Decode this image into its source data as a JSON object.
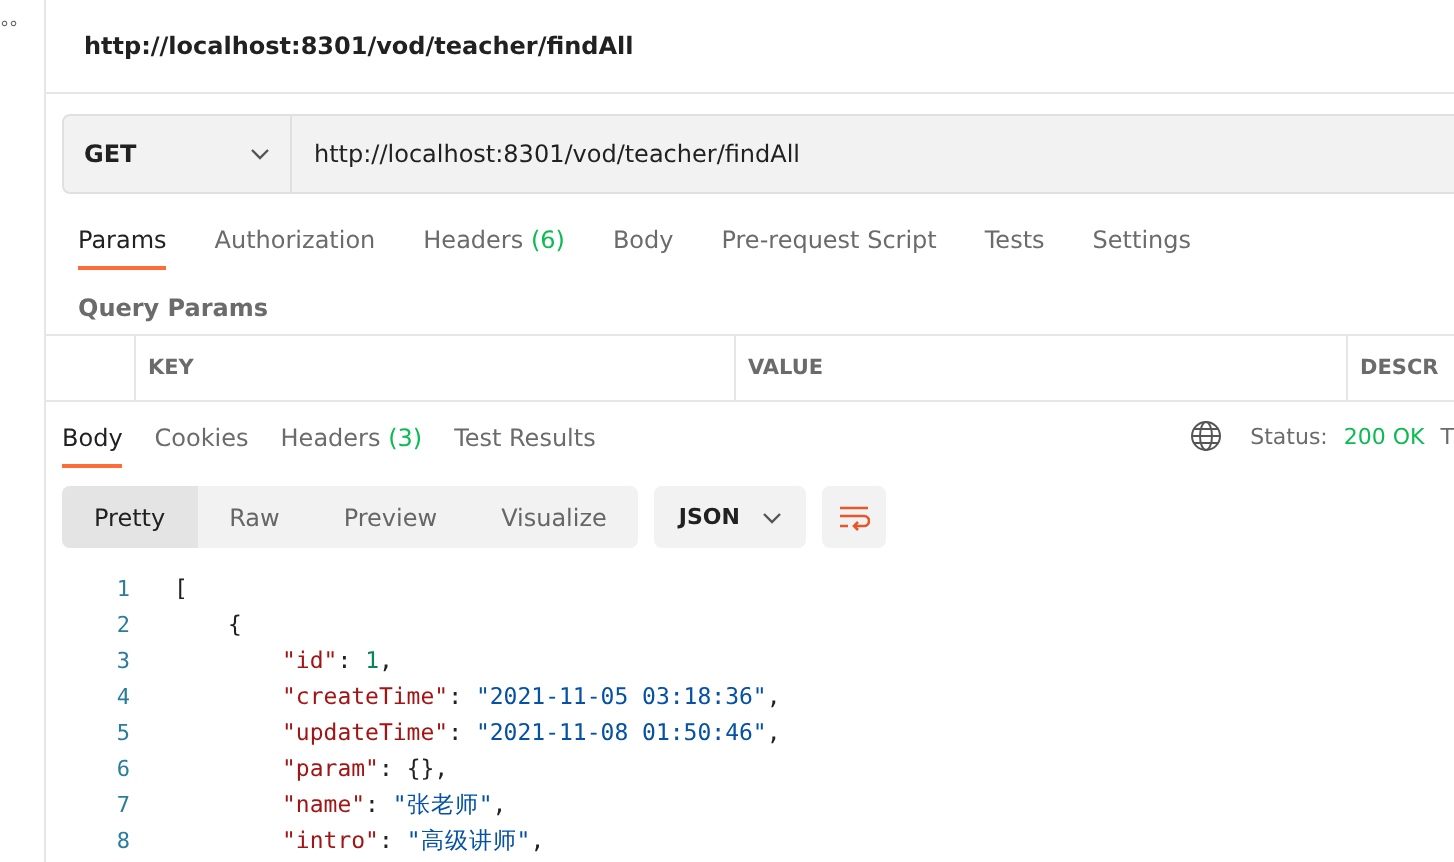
{
  "sidebar": {
    "icon_text": "°°"
  },
  "request": {
    "title": "http://localhost:8301/vod/teacher/findAll",
    "method": "GET",
    "url": "http://localhost:8301/vod/teacher/findAll"
  },
  "request_tabs": [
    {
      "label": "Params",
      "selected": true
    },
    {
      "label": "Authorization",
      "selected": false
    },
    {
      "label": "Headers",
      "count": "(6)",
      "selected": false
    },
    {
      "label": "Body",
      "selected": false
    },
    {
      "label": "Pre-request Script",
      "selected": false
    },
    {
      "label": "Tests",
      "selected": false
    },
    {
      "label": "Settings",
      "selected": false
    }
  ],
  "params": {
    "title": "Query Params",
    "columns": [
      "KEY",
      "VALUE",
      "DESCR"
    ]
  },
  "response_tabs": [
    {
      "label": "Body",
      "selected": true
    },
    {
      "label": "Cookies",
      "selected": false
    },
    {
      "label": "Headers",
      "count": "(3)",
      "selected": false
    },
    {
      "label": "Test Results",
      "selected": false
    }
  ],
  "status": {
    "label": "Status:",
    "value": "200 OK",
    "extra": "T"
  },
  "view_modes": [
    {
      "label": "Pretty",
      "selected": true
    },
    {
      "label": "Raw",
      "selected": false
    },
    {
      "label": "Preview",
      "selected": false
    },
    {
      "label": "Visualize",
      "selected": false
    }
  ],
  "format": "JSON",
  "code_lines": [
    {
      "number": "1",
      "tokens": [
        {
          "kind": "punct",
          "text": "["
        }
      ],
      "children": [
        {
          "number": "2",
          "tokens": [
            {
              "kind": "punct",
              "text": "{"
            }
          ],
          "children": [
            {
              "number": "3",
              "tokens": [
                {
                  "kind": "key",
                  "text": "\"id\""
                },
                {
                  "kind": "punct",
                  "text": ": "
                },
                {
                  "kind": "number",
                  "text": "1"
                },
                {
                  "kind": "punct",
                  "text": ","
                }
              ]
            },
            {
              "number": "4",
              "tokens": [
                {
                  "kind": "key",
                  "text": "\"createTime\""
                },
                {
                  "kind": "punct",
                  "text": ": "
                },
                {
                  "kind": "string",
                  "text": "\"2021-11-05 03:18:36\""
                },
                {
                  "kind": "punct",
                  "text": ","
                }
              ]
            },
            {
              "number": "5",
              "tokens": [
                {
                  "kind": "key",
                  "text": "\"updateTime\""
                },
                {
                  "kind": "punct",
                  "text": ": "
                },
                {
                  "kind": "string",
                  "text": "\"2021-11-08 01:50:46\""
                },
                {
                  "kind": "punct",
                  "text": ","
                }
              ]
            },
            {
              "number": "6",
              "tokens": [
                {
                  "kind": "key",
                  "text": "\"param\""
                },
                {
                  "kind": "punct",
                  "text": ": {},"
                }
              ]
            },
            {
              "number": "7",
              "tokens": [
                {
                  "kind": "key",
                  "text": "\"name\""
                },
                {
                  "kind": "punct",
                  "text": ": "
                },
                {
                  "kind": "string",
                  "text": "\"张老师\""
                },
                {
                  "kind": "punct",
                  "text": ","
                }
              ]
            },
            {
              "number": "8",
              "tokens": [
                {
                  "kind": "key",
                  "text": "\"intro\""
                },
                {
                  "kind": "punct",
                  "text": ": "
                },
                {
                  "kind": "string",
                  "text": "\"高级讲师\""
                },
                {
                  "kind": "punct",
                  "text": ","
                }
              ]
            }
          ]
        }
      ]
    }
  ]
}
